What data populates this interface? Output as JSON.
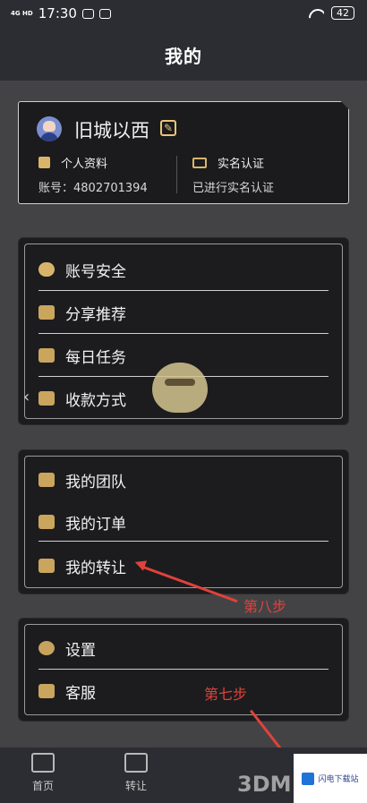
{
  "status_bar": {
    "signal_label": "4G HD",
    "time": "17:30",
    "battery": "42"
  },
  "nav": {
    "title": "我的"
  },
  "profile": {
    "name": "旧城以西",
    "personal_info_label": "个人资料",
    "account_text": "账号：4802701394",
    "realname_label": "实名认证",
    "realname_status": "已进行实名认证"
  },
  "menu_group_1": [
    {
      "label": "账号安全",
      "icon": "shield-icon"
    },
    {
      "label": "分享推荐",
      "icon": "gift-box-icon"
    },
    {
      "label": "每日任务",
      "icon": "task-icon"
    },
    {
      "label": "收款方式",
      "icon": "qr-code-icon"
    }
  ],
  "menu_group_2": [
    {
      "label": "我的团队",
      "icon": "team-icon"
    },
    {
      "label": "我的订单",
      "icon": "order-icon"
    },
    {
      "label": "我的转让",
      "icon": "transfer-icon"
    }
  ],
  "menu_group_3": [
    {
      "label": "设置",
      "icon": "gear-icon"
    },
    {
      "label": "客服",
      "icon": "customer-service-icon"
    }
  ],
  "annotations": {
    "step8": "第八步",
    "step7": "第七步"
  },
  "tabbar": [
    {
      "label": "首页",
      "icon": "home-video-icon"
    },
    {
      "label": "转让",
      "icon": "transfer-door-icon"
    }
  ],
  "watermark": {
    "site": "闪电下载站",
    "brand": "3DM"
  },
  "colors": {
    "accent_gold": "#d9b56b",
    "annotation_red": "#e0423b",
    "bar_bg": "#2b2d33",
    "page_bg": "#434346"
  }
}
